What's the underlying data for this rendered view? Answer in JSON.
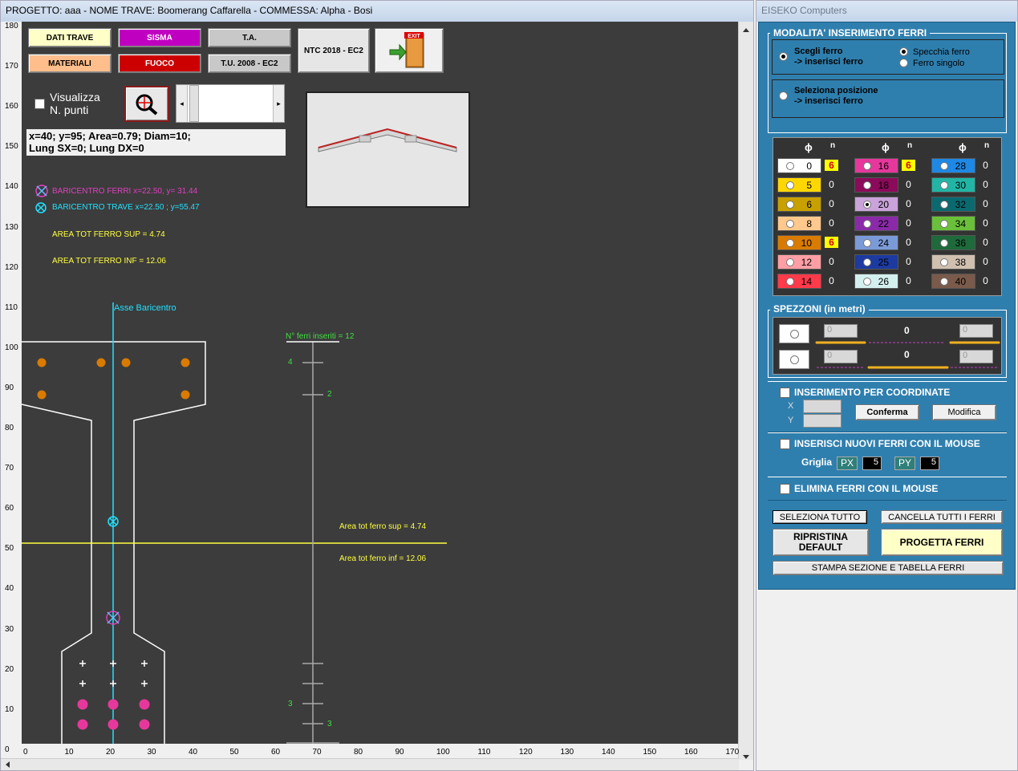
{
  "main_window": {
    "title": "PROGETTO: aaa - NOME TRAVE: Boomerang Caffarella - COMMESSA: Alpha - Bosi",
    "buttons": {
      "dati_trave": "DATI TRAVE",
      "sisma": "SISMA",
      "ta": "T.A.",
      "ntc": "NTC 2018 - EC2",
      "materiali": "MATERIALI",
      "fuoco": "FUOCO",
      "tu": "T.U. 2008 - EC2",
      "exit": "EXIT"
    },
    "visualizza_label": "Visualizza",
    "npunti_label": "N. punti",
    "info_line1": "x=40; y=95; Area=0.79; Diam=10;",
    "info_line2": "Lung SX=0; Lung DX=0",
    "legend": {
      "baricentro_ferri": "BARICENTRO FERRI  x=22.50, y= 31.44",
      "baricentro_trave": "BARICENTRO TRAVE  x=22.50 ; y=55.47",
      "area_sup": "AREA TOT FERRO SUP =  4.74",
      "area_inf": "AREA TOT FERRO INF =  12.06"
    },
    "plot": {
      "asse_label": "Asse Baricentro",
      "nferri_label": "N° ferri inseriti = 12",
      "area_sup_label": "Area tot ferro sup  = 4.74",
      "area_inf_label": "Area tot ferro inf  = 12.06",
      "count_4": "4",
      "count_2": "2",
      "count_3a": "3",
      "count_3b": "3",
      "y_ticks": [
        "180",
        "170",
        "160",
        "150",
        "140",
        "130",
        "120",
        "110",
        "100",
        "90",
        "80",
        "70",
        "60",
        "50",
        "40",
        "30",
        "20",
        "10",
        "0"
      ],
      "x_ticks": [
        "0",
        "10",
        "20",
        "30",
        "40",
        "50",
        "60",
        "70",
        "80",
        "90",
        "100",
        "110",
        "120",
        "130",
        "140",
        "150",
        "160",
        "170"
      ]
    }
  },
  "side_window": {
    "title": "EISEKO Computers",
    "modalita_title": "MODALITA' INSERIMENTO FERRI",
    "scegli_line1": "Scegli ferro",
    "scegli_line2": "-> inserisci ferro",
    "specchia": "Specchia ferro",
    "singolo": "Ferro singolo",
    "seleziona_line1": "Seleziona posizione",
    "seleziona_line2": "-> inserisci ferro",
    "phi_symbol": "ϕ",
    "n_symbol": "n",
    "palette": [
      {
        "d": "0",
        "n": "6",
        "color": "#ffffff",
        "text": "#000000",
        "hl": true,
        "sel": false
      },
      {
        "d": "5",
        "n": "0",
        "color": "#ffd700",
        "text": "#000000",
        "hl": false,
        "sel": false
      },
      {
        "d": "6",
        "n": "0",
        "color": "#c8a000",
        "text": "#000000",
        "hl": false,
        "sel": false
      },
      {
        "d": "8",
        "n": "0",
        "color": "#ffc88c",
        "text": "#000000",
        "hl": false,
        "sel": false
      },
      {
        "d": "10",
        "n": "6",
        "color": "#d97b00",
        "text": "#000000",
        "hl": true,
        "sel": false
      },
      {
        "d": "12",
        "n": "0",
        "color": "#ff9fa5",
        "text": "#000000",
        "hl": false,
        "sel": false
      },
      {
        "d": "14",
        "n": "0",
        "color": "#ff3a4a",
        "text": "#000000",
        "hl": false,
        "sel": false
      },
      {
        "d": "16",
        "n": "6",
        "color": "#e6389c",
        "text": "#000000",
        "hl": true,
        "sel": false
      },
      {
        "d": "18",
        "n": "0",
        "color": "#8b0a5a",
        "text": "#000000",
        "hl": false,
        "sel": false
      },
      {
        "d": "20",
        "n": "0",
        "color": "#c9a3d9",
        "text": "#000000",
        "hl": false,
        "sel": true
      },
      {
        "d": "22",
        "n": "0",
        "color": "#8a2aa8",
        "text": "#000000",
        "hl": false,
        "sel": false
      },
      {
        "d": "24",
        "n": "0",
        "color": "#7b9ad8",
        "text": "#000000",
        "hl": false,
        "sel": false
      },
      {
        "d": "25",
        "n": "0",
        "color": "#1c3aa0",
        "text": "#000000",
        "hl": false,
        "sel": false
      },
      {
        "d": "26",
        "n": "0",
        "color": "#d3f0ee",
        "text": "#000000",
        "hl": false,
        "sel": false
      },
      {
        "d": "28",
        "n": "0",
        "color": "#1e88e5",
        "text": "#000000",
        "hl": false,
        "sel": false
      },
      {
        "d": "30",
        "n": "0",
        "color": "#22b5a5",
        "text": "#000000",
        "hl": false,
        "sel": false
      },
      {
        "d": "32",
        "n": "0",
        "color": "#0a6a70",
        "text": "#000000",
        "hl": false,
        "sel": false
      },
      {
        "d": "34",
        "n": "0",
        "color": "#6ac03a",
        "text": "#000000",
        "hl": false,
        "sel": false
      },
      {
        "d": "36",
        "n": "0",
        "color": "#1e6a3a",
        "text": "#000000",
        "hl": false,
        "sel": false
      },
      {
        "d": "38",
        "n": "0",
        "color": "#d0c0b0",
        "text": "#000000",
        "hl": false,
        "sel": false
      },
      {
        "d": "40",
        "n": "0",
        "color": "#7a5a4a",
        "text": "#000000",
        "hl": false,
        "sel": false
      }
    ],
    "spezzoni_title": "SPEZZONI (in metri)",
    "spezzoni": {
      "a1": "0",
      "a2": "0",
      "amid": "0",
      "b1": "0",
      "b2": "0",
      "bmid": "0"
    },
    "ins_coord": "INSERIMENTO PER COORDINATE",
    "x_label": "X",
    "y_label": "Y",
    "conferma": "Conferma",
    "modifica": "Modifica",
    "ins_mouse": "INSERISCI NUOVI FERRI CON IL MOUSE",
    "griglia": "Griglia",
    "px_label": "PX",
    "px_value": "5",
    "py_label": "PY",
    "py_value": "5",
    "elimina": "ELIMINA FERRI CON IL MOUSE",
    "seleziona_tutto": "SELEZIONA TUTTO",
    "cancella_tutti": "CANCELLA TUTTI I FERRI",
    "ripristina_line1": "RIPRISTINA",
    "ripristina_line2": "DEFAULT",
    "progetta": "PROGETTA FERRI",
    "stampa": "STAMPA SEZIONE E TABELLA FERRI"
  }
}
